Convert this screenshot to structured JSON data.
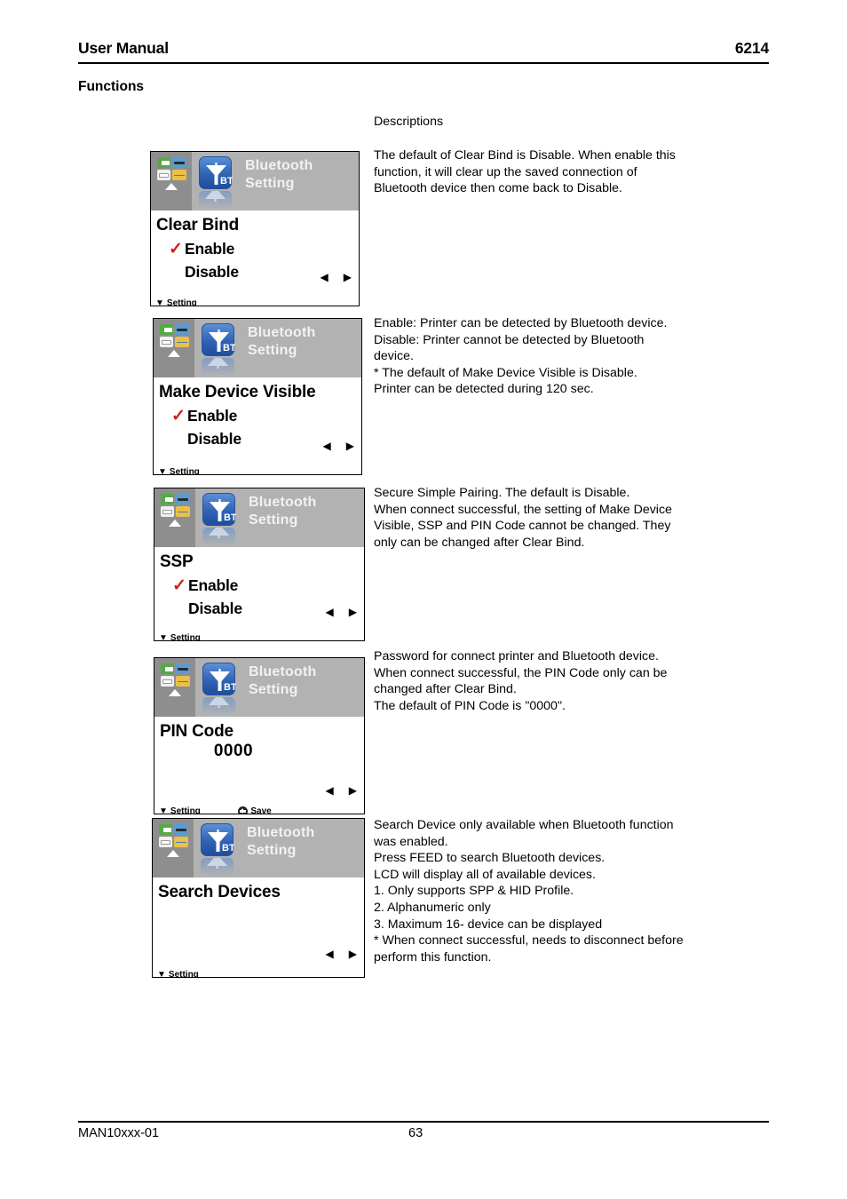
{
  "header": {
    "left_title": "User Manual",
    "right_title": "6214"
  },
  "section_title": "Functions",
  "descriptions_heading": "Descriptions",
  "screens": [
    {
      "status_icons": [
        "media-icon",
        "printer-icon",
        "label-icon",
        "ribbon-icon"
      ],
      "bt_icon_label": "BT",
      "title_line1": "Bluetooth",
      "title_line2": "Setting",
      "heading": "Clear Bind",
      "options": [
        {
          "label": "Enable",
          "checked": true
        },
        {
          "label": "Disable",
          "checked": false
        }
      ],
      "value": "",
      "footer_setting": "Setting",
      "footer_save": "",
      "left_arrow": "◀",
      "right_arrow": "▶",
      "description": "The default of Clear Bind is Disable. When enable this\nfunction, it will clear up the saved connection of\nBluetooth device then come back to Disable."
    },
    {
      "status_icons": [
        "media-icon",
        "printer-icon",
        "label-icon",
        "ribbon-icon"
      ],
      "bt_icon_label": "BT",
      "title_line1": "Bluetooth",
      "title_line2": "Setting",
      "heading": "Make Device Visible",
      "options": [
        {
          "label": "Enable",
          "checked": true
        },
        {
          "label": "Disable",
          "checked": false
        }
      ],
      "value": "",
      "footer_setting": "Setting",
      "footer_save": "",
      "left_arrow": "◀",
      "right_arrow": "▶",
      "description": "Enable: Printer can be detected by Bluetooth device.\nDisable: Printer cannot be detected by Bluetooth\ndevice.\n* The default of Make Device Visible is Disable.\nPrinter can be detected during 120 sec."
    },
    {
      "status_icons": [
        "media-icon",
        "printer-icon",
        "label-icon",
        "ribbon-icon"
      ],
      "bt_icon_label": "BT",
      "title_line1": "Bluetooth",
      "title_line2": "Setting",
      "heading": "SSP",
      "options": [
        {
          "label": "Enable",
          "checked": true
        },
        {
          "label": "Disable",
          "checked": false
        }
      ],
      "value": "",
      "footer_setting": "Setting",
      "footer_save": "",
      "left_arrow": "◀",
      "right_arrow": "▶",
      "description": "Secure Simple Pairing. The default is Disable.\nWhen connect successful, the setting of Make Device\nVisible, SSP and PIN Code cannot be changed. They\nonly can be changed after Clear Bind."
    },
    {
      "status_icons": [
        "media-icon",
        "printer-icon",
        "label-icon",
        "ribbon-icon"
      ],
      "bt_icon_label": "BT",
      "title_line1": "Bluetooth",
      "title_line2": "Setting",
      "heading": "PIN Code",
      "options": [],
      "value": "0000",
      "footer_setting": "Setting",
      "footer_save": "Save",
      "left_arrow": "◀",
      "right_arrow": "▶",
      "description": "Password for connect printer and Bluetooth device.\nWhen connect successful, the PIN Code only can be\nchanged after Clear Bind.\nThe default of PIN Code is \"0000\"."
    },
    {
      "status_icons": [
        "media-icon",
        "printer-icon",
        "label-icon",
        "ribbon-icon"
      ],
      "bt_icon_label": "BT",
      "title_line1": "Bluetooth",
      "title_line2": "Setting",
      "heading": "Search Devices",
      "options": [],
      "value": "",
      "footer_setting": "Setting",
      "footer_save": "",
      "left_arrow": "◀",
      "right_arrow": "▶",
      "description": "Search Device only available when Bluetooth function\nwas enabled.\nPress FEED to search Bluetooth devices.\nLCD will display all of available devices.\n1. Only supports SPP & HID Profile.\n2. Alphanumeric only\n3. Maximum 16- device can be displayed\n* When connect successful, needs to disconnect before\nperform this function."
    }
  ],
  "footer": {
    "doc_id": "MAN10xxx-01",
    "page_number": "63"
  },
  "colors": {
    "lcd_header_bg": "#b2b2b2",
    "lcd_tray_bg": "#8e8e8e",
    "bt_blue": "#2f63b5",
    "check_red": "#cc1e21"
  }
}
